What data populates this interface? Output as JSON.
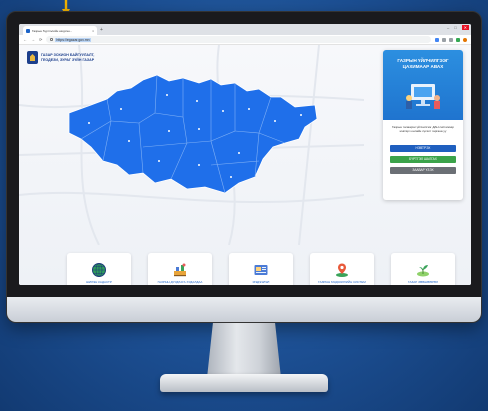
{
  "browser": {
    "tab_title": "Газрын бүртгэлийн нэгдсэн...",
    "new_tab": "+",
    "tab_close": "×",
    "url": "https://egazar.gov.mn",
    "window_controls": [
      "–",
      "□",
      "✕"
    ]
  },
  "site": {
    "logo_line1": "ГАЗАР ЗОХИОН БАЙГУУЛАЛТ,",
    "logo_line2": "ГЕОДЕЗИ, ЗУРАГ ЗҮЙН ГАЗАР"
  },
  "card": {
    "title": "ГАЗРЫН ҮЙЛЧИЛГЭЭГ ЦАХИМААР АВАХ",
    "description": "Газрын талаархи үйлчилгээг ДАН системээр нэвтэрч онлайн хүсэлт гаргана уу",
    "buttons": [
      "НЭВТРЭХ",
      "БҮРТГЭЛ ШАЛГАХ",
      "ЗААВАР ҮЗЭХ"
    ]
  },
  "services": [
    {
      "label": "ШИЛЭН КАДАСТР",
      "icon": "globe-icon"
    },
    {
      "label": "ГАЗРЫН ДУУДЛАГА ХУДАЛДАА",
      "icon": "auction-icon"
    },
    {
      "label": "МЭДЭЭЛЭЛ",
      "icon": "news-icon"
    },
    {
      "label": "ГАЗРЫН МЭДЭЭЛЛИЙН СИСТЕМ",
      "icon": "location-pin-icon"
    },
    {
      "label": "ГАЗАР ЗӨВШӨӨРӨЛ",
      "icon": "land-permit-icon"
    }
  ],
  "colors": {
    "map_fill": "#1f6fea",
    "accent": "#1d64c8",
    "background": "#1c4f93"
  }
}
